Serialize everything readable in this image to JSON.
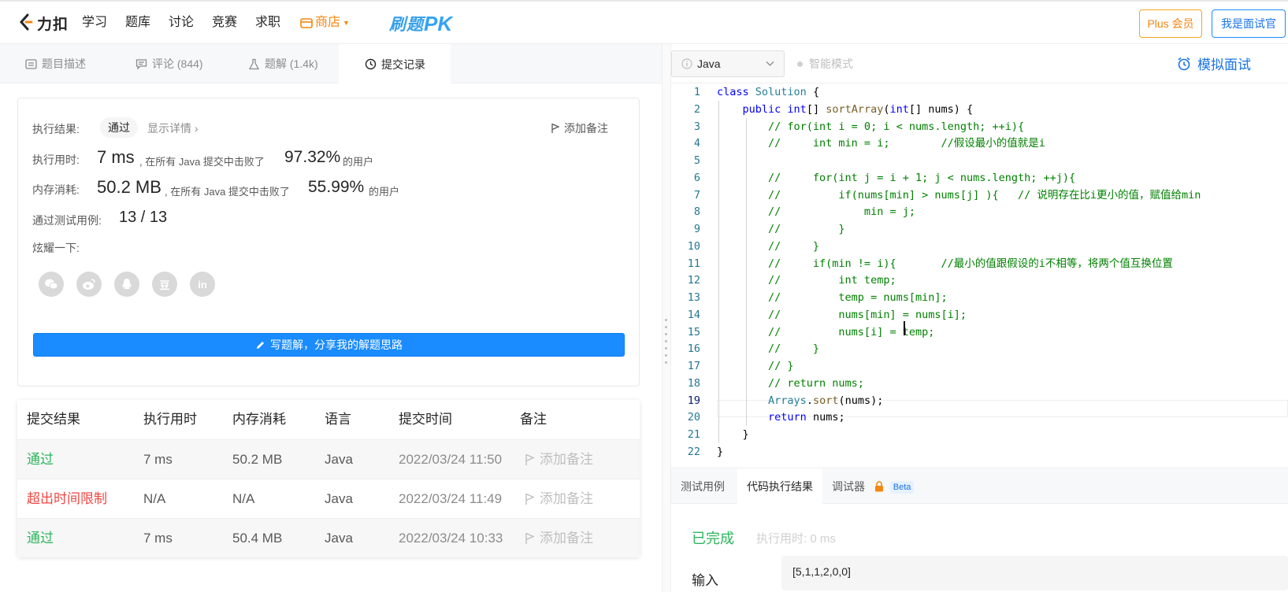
{
  "nav": {
    "logo_text": "力扣",
    "items": [
      "学习",
      "题库",
      "讨论",
      "竞赛",
      "求职"
    ],
    "store": "商店",
    "pk_text_1": "刷题",
    "pk_text_2": "PK",
    "plus": "Plus 会员",
    "interviewer": "我是面试官"
  },
  "tabs": [
    {
      "label": "题目描述",
      "icon": "doc-icon"
    },
    {
      "label": "评论 (844)",
      "icon": "comment-icon"
    },
    {
      "label": "题解 (1.4k)",
      "icon": "flask-icon"
    },
    {
      "label": "提交记录",
      "icon": "clock-icon"
    }
  ],
  "summary": {
    "result_label": "执行结果:",
    "result_value": "通过",
    "detail_link": "显示详情 ›",
    "add_note": "添加备注",
    "time_label": "执行用时:",
    "time_value": "7 ms",
    "time_mid": ", 在所有 Java 提交中击败了",
    "time_pct": "97.32%",
    "time_suffix": "的用户",
    "mem_label": "内存消耗:",
    "mem_value": "50.2 MB",
    "mem_mid": ", 在所有 Java 提交中击败了",
    "mem_pct": "55.99%",
    "mem_suffix": "的用户",
    "cases_label": "通过测试用例:",
    "cases_value": "13 / 13",
    "share_label": "炫耀一下:",
    "share_icons": [
      "wechat-icon",
      "weibo-icon",
      "qq-icon",
      "douban-icon",
      "linkedin-icon"
    ],
    "douban_glyph": "豆",
    "linkedin_glyph": "in",
    "write_button": "写题解，分享我的解题思路"
  },
  "submissions": {
    "headers": [
      "提交结果",
      "执行用时",
      "内存消耗",
      "语言",
      "提交时间",
      "备注"
    ],
    "rows": [
      {
        "result": "通过",
        "time": "7 ms",
        "memory": "50.2 MB",
        "lang": "Java",
        "submitted": "2022/03/24 11:50",
        "note": "添加备注"
      },
      {
        "result": "超出时间限制",
        "time": "N/A",
        "memory": "N/A",
        "lang": "Java",
        "submitted": "2022/03/24 11:49",
        "note": "添加备注"
      },
      {
        "result": "通过",
        "time": "7 ms",
        "memory": "50.4 MB",
        "lang": "Java",
        "submitted": "2022/03/24 10:33",
        "note": "添加备注"
      }
    ]
  },
  "editor": {
    "language": "Java",
    "smart_mode": "智能模式",
    "mock_interview": "模拟面试",
    "line_numbers": [
      "1",
      "2",
      "3",
      "4",
      "5",
      "6",
      "7",
      "8",
      "9",
      "10",
      "11",
      "12",
      "13",
      "14",
      "15",
      "16",
      "17",
      "18",
      "19",
      "20",
      "21",
      "22"
    ],
    "lines": [
      [
        {
          "t": "class ",
          "c": "kw"
        },
        {
          "t": "Solution",
          "c": "ty"
        },
        {
          "t": " {",
          "c": ""
        }
      ],
      [
        {
          "t": "    ",
          "c": ""
        },
        {
          "t": "public ",
          "c": "kw"
        },
        {
          "t": "int",
          "c": "kw"
        },
        {
          "t": "[] ",
          "c": ""
        },
        {
          "t": "sortArray",
          "c": "fn"
        },
        {
          "t": "(",
          "c": ""
        },
        {
          "t": "int",
          "c": "kw"
        },
        {
          "t": "[] nums) {",
          "c": ""
        }
      ],
      [
        {
          "t": "        // for(int i = 0; i < nums.length; ++i){",
          "c": "cm"
        }
      ],
      [
        {
          "t": "        //     int min = i;        //假设最小的值就是i",
          "c": "cm"
        }
      ],
      [
        {
          "t": "",
          "c": ""
        }
      ],
      [
        {
          "t": "        //     for(int j = i + 1; j < nums.length; ++j){",
          "c": "cm"
        }
      ],
      [
        {
          "t": "        //         if(nums[min] > nums[j] ){   // 说明存在比i更小的值，赋值给min",
          "c": "cm"
        }
      ],
      [
        {
          "t": "        //             min = j;",
          "c": "cm"
        }
      ],
      [
        {
          "t": "        //         }",
          "c": "cm"
        }
      ],
      [
        {
          "t": "        //     }",
          "c": "cm"
        }
      ],
      [
        {
          "t": "        //     if(min != i){       //最小的值跟假设的i不相等，将两个值互换位置",
          "c": "cm"
        }
      ],
      [
        {
          "t": "        //         int temp;",
          "c": "cm"
        }
      ],
      [
        {
          "t": "        //         temp = nums[min];",
          "c": "cm"
        }
      ],
      [
        {
          "t": "        //         nums[min] = nums[i];",
          "c": "cm"
        }
      ],
      [
        {
          "t": "        //         nums[i] = temp;",
          "c": "cm"
        }
      ],
      [
        {
          "t": "        //     }",
          "c": "cm"
        }
      ],
      [
        {
          "t": "        // }",
          "c": "cm"
        }
      ],
      [
        {
          "t": "        // return nums;",
          "c": "cm"
        }
      ],
      [
        {
          "t": "        ",
          "c": ""
        },
        {
          "t": "Arrays",
          "c": "ty"
        },
        {
          "t": ".",
          "c": ""
        },
        {
          "t": "sort",
          "c": "fn"
        },
        {
          "t": "(nums);",
          "c": ""
        }
      ],
      [
        {
          "t": "        ",
          "c": ""
        },
        {
          "t": "return ",
          "c": "kw"
        },
        {
          "t": "nums;",
          "c": ""
        }
      ],
      [
        {
          "t": "    }",
          "c": ""
        }
      ],
      [
        {
          "t": "}",
          "c": ""
        }
      ]
    ]
  },
  "bottom_tabs": {
    "testcase": "测试用例",
    "result": "代码执行结果",
    "debugger": "调试器",
    "beta": "Beta"
  },
  "run_result": {
    "status": "已完成",
    "exec_time": "执行用时: 0 ms",
    "input_label": "输入",
    "input_value": "[5,1,1,2,0,0]"
  }
}
